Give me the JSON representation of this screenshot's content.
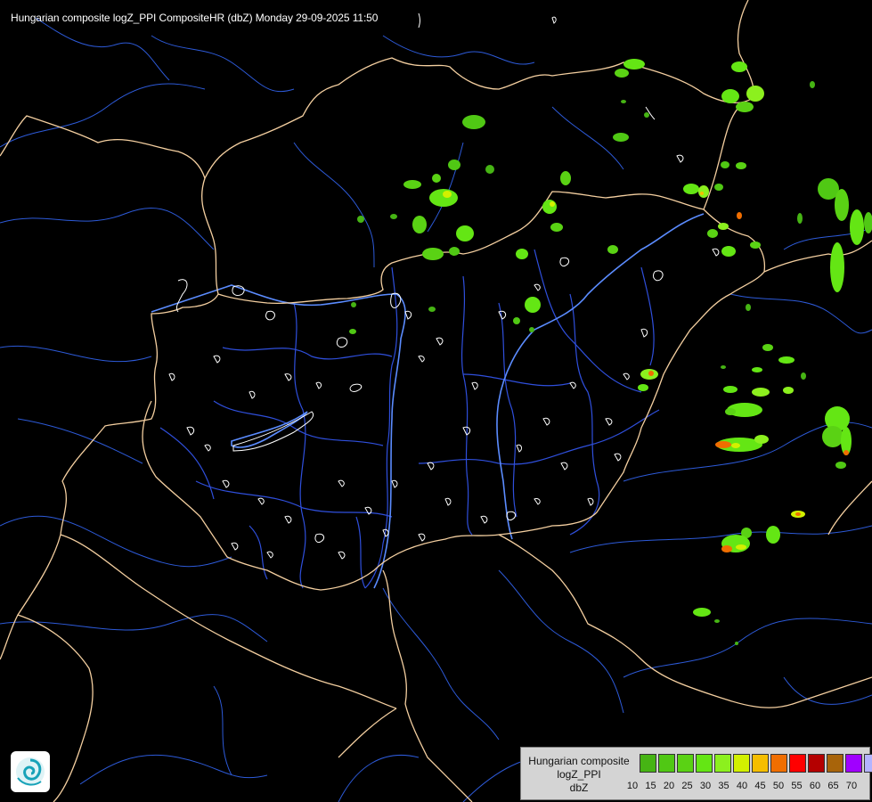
{
  "header": {
    "title": "Hungarian composite logZ_PPI CompositeHR (dbZ) Monday 29-09-2025 11:50"
  },
  "legend": {
    "lines": [
      "Hungarian composite",
      "logZ_PPI",
      "dbZ"
    ],
    "bins": [
      {
        "value": "10",
        "color": "#46b414"
      },
      {
        "value": "15",
        "color": "#50c814"
      },
      {
        "value": "20",
        "color": "#5ad214"
      },
      {
        "value": "25",
        "color": "#64e614"
      },
      {
        "value": "30",
        "color": "#8cf01e"
      },
      {
        "value": "35",
        "color": "#d2f000"
      },
      {
        "value": "40",
        "color": "#f5be00"
      },
      {
        "value": "45",
        "color": "#f06e00"
      },
      {
        "value": "50",
        "color": "#ff0000"
      },
      {
        "value": "55",
        "color": "#b40000"
      },
      {
        "value": "60",
        "color": "#a8640a"
      },
      {
        "value": "65",
        "color": "#a000ff"
      },
      {
        "value": "70",
        "color": "#b4b4ff"
      }
    ],
    "tick_labels": [
      "10",
      "15",
      "20",
      "25",
      "30",
      "35",
      "40",
      "45",
      "50",
      "55",
      "60",
      "65",
      "70"
    ]
  },
  "logo": {
    "icon": "omsz-logo-icon"
  },
  "map": {
    "colors": {
      "background": "#000000",
      "river": "#3c6eff",
      "country_border": "#ffd2a0",
      "county_border": "#3050e0",
      "lake": "#ffffff"
    }
  }
}
